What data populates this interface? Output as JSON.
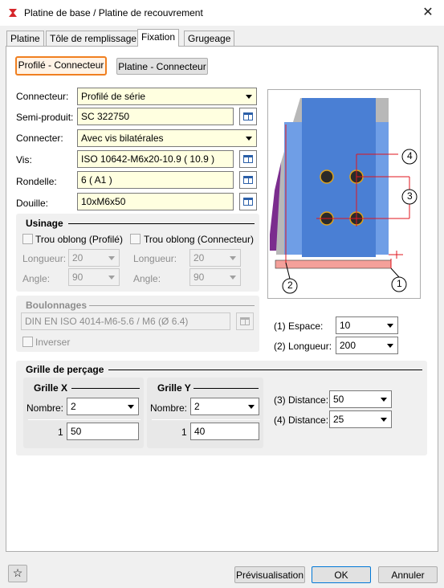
{
  "window": {
    "title": "Platine de base / Platine de recouvrement"
  },
  "tabs": [
    {
      "label": "Platine"
    },
    {
      "label": "Tôle de remplissage"
    },
    {
      "label": "Fixation"
    },
    {
      "label": "Grugeage"
    }
  ],
  "mode_buttons": {
    "profile_connector": "Profilé - Connecteur",
    "plate_connector": "Platine - Connecteur"
  },
  "form": {
    "connecteur": {
      "label": "Connecteur:",
      "value": "Profilé de série"
    },
    "semi_produit": {
      "label": "Semi-produit:",
      "value": "SC  322750"
    },
    "connecter": {
      "label": "Connecter:",
      "value": "Avec vis bilatérales"
    },
    "vis": {
      "label": "Vis:",
      "value": "ISO 10642-M6x20-10.9  ( 10.9 )"
    },
    "rondelle": {
      "label": "Rondelle:",
      "value": "6  ( A1 )"
    },
    "douille": {
      "label": "Douille:",
      "value": "10xM6x50"
    }
  },
  "usinage": {
    "title": "Usinage",
    "trou_profile": "Trou oblong (Profilé)",
    "trou_connecteur": "Trou oblong (Connecteur)",
    "longueur_label": "Longueur:",
    "angle_label": "Angle:",
    "longueur_left": "20",
    "angle_left": "90",
    "longueur_right": "20",
    "angle_right": "90"
  },
  "boulonnages": {
    "title": "Boulonnages",
    "value": "DIN EN ISO 4014-M6-5.6 / M6 (Ø 6.4)",
    "inverser": "Inverser"
  },
  "espace": {
    "label": "(1) Espace:",
    "value": "10"
  },
  "longueur": {
    "label": "(2) Longueur:",
    "value": "200"
  },
  "preview_labels": {
    "n1": "1",
    "n2": "2",
    "n3": "3",
    "n4": "4"
  },
  "grille": {
    "title": "Grille de perçage",
    "x": {
      "title": "Grille X",
      "nombre_label": "Nombre:",
      "nombre": "2",
      "row_index": "1",
      "row_value": "50"
    },
    "y": {
      "title": "Grille Y",
      "nombre_label": "Nombre:",
      "nombre": "2",
      "row_index": "1",
      "row_value": "40"
    },
    "distance3": {
      "label": "(3) Distance:",
      "value": "50"
    },
    "distance4": {
      "label": "(4) Distance:",
      "value": "25"
    }
  },
  "footer": {
    "preview": "Prévisualisation",
    "ok": "OK",
    "cancel": "Annuler"
  },
  "colors": {
    "accent_orange": "#f07f20",
    "field_yellow": "#ffffe0",
    "preview_blue": "#4a7fd4",
    "pink": "#f4a09a",
    "purple": "#7b2d8e"
  }
}
